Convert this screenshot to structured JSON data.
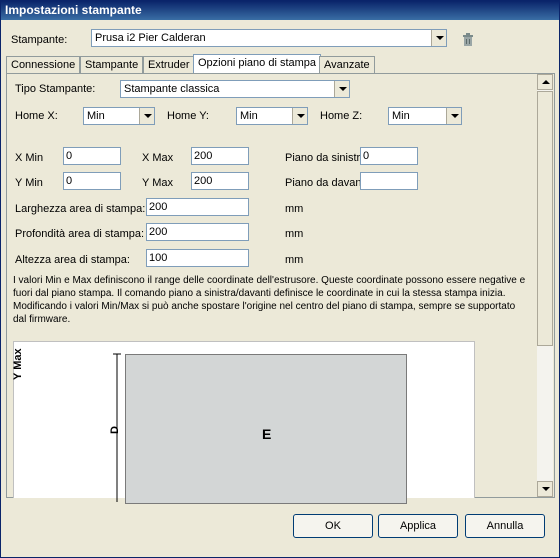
{
  "window": {
    "title": "Impostazioni stampante"
  },
  "printer": {
    "label": "Stampante:",
    "selected": "Prusa i2 Pier Calderan"
  },
  "icons": {
    "delete": "trash-icon",
    "dropdown": "chevron-down-icon"
  },
  "tabs": [
    {
      "label": "Connessione",
      "active": false
    },
    {
      "label": "Stampante",
      "active": false
    },
    {
      "label": "Extruder",
      "active": false
    },
    {
      "label": "Opzioni piano di stampa",
      "active": true
    },
    {
      "label": "Avanzate",
      "active": false
    }
  ],
  "bed": {
    "type_label": "Tipo Stampante:",
    "type_value": "Stampante classica",
    "home_x_label": "Home X:",
    "home_x_value": "Min",
    "home_y_label": "Home Y:",
    "home_y_value": "Min",
    "home_z_label": "Home Z:",
    "home_z_value": "Min",
    "xmin_label": "X Min",
    "xmin_value": "0",
    "xmax_label": "X Max",
    "xmax_value": "200",
    "ymin_label": "Y Min",
    "ymin_value": "0",
    "ymax_label": "Y Max",
    "ymax_value": "200",
    "left_label": "Piano da sinistra:",
    "left_value": "0",
    "front_label": "Piano da davanti:",
    "front_value": "",
    "width_label": "Larghezza area di stampa:",
    "width_value": "200",
    "depth_label": "Profondità area di stampa:",
    "depth_value": "200",
    "height_label": "Altezza area di stampa:",
    "height_value": "100",
    "unit": "mm",
    "description": "I valori Min e Max definiscono il range delle coordinate dell'estrusore. Queste coordinate possono essere negative e fuori dal piano stampa. Il comando piano a sinistra/davanti definisce le coordinate in cui la stessa stampa inizia. Modificando i valori Min/Max si può anche spostare l'origine nel centro del piano di stampa, sempre se supportato dal firmware."
  },
  "diagram": {
    "axis_label": "Y Max",
    "dim_label": "D",
    "area_label": "E"
  },
  "buttons": {
    "ok": "OK",
    "apply": "Applica",
    "cancel": "Annulla"
  },
  "colors": {
    "title_bar": "#0a246a",
    "panel_bg": "#ece9d8",
    "bed_fill": "#d3d6d6"
  }
}
